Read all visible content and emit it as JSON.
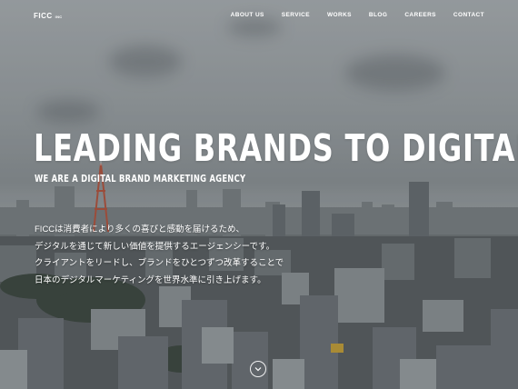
{
  "header": {
    "logo_text": "FICC",
    "logo_suffix": "INC"
  },
  "nav": {
    "items": [
      {
        "label": "ABOUT US"
      },
      {
        "label": "SERVICE"
      },
      {
        "label": "WORKS"
      },
      {
        "label": "BLOG"
      },
      {
        "label": "CAREERS"
      },
      {
        "label": "CONTACT"
      }
    ]
  },
  "hero": {
    "headline": "LEADING BRANDS TO DIGITAL",
    "subheadline": "WE ARE A DIGITAL BRAND MARKETING AGENCY",
    "description": [
      "FICCは消費者により多くの喜びと感動を届けるため、",
      "デジタルを通じて新しい価値を提供するエージェンシーです。",
      "クライアントをリードし、ブランドをひとつずつ改革することで",
      "日本のデジタルマーケティングを世界水準に引き上げます。"
    ],
    "background": "aerial photo of Tokyo skyline under cloudy sky"
  },
  "scroll_icon": "chevron-down-icon"
}
